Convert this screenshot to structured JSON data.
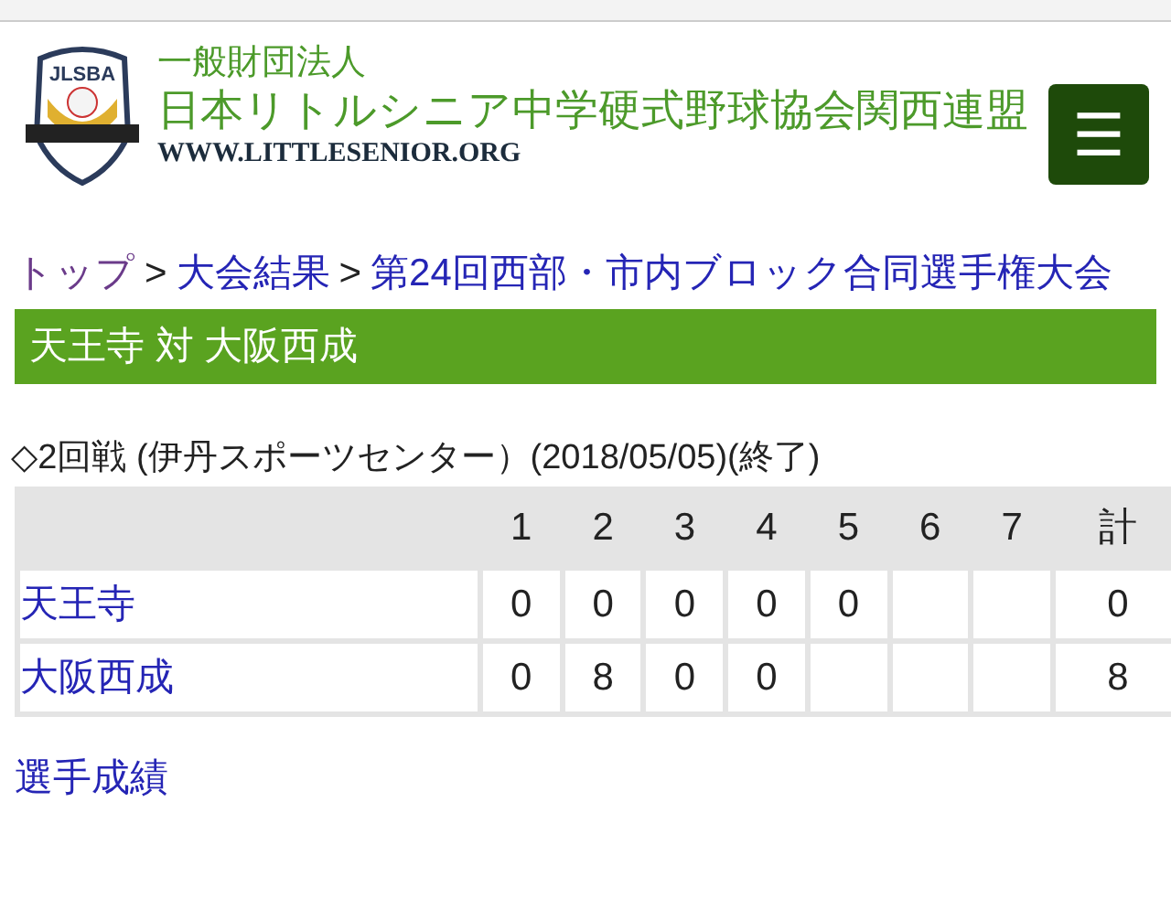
{
  "header": {
    "logo_text": "JLSBA",
    "org_type": "一般財団法人",
    "org_name": "日本リトルシニア中学硬式野球協会関西連盟",
    "url": "WWW.LITTLESENIOR.ORG",
    "menu_button": "☰"
  },
  "breadcrumb": [
    {
      "label": "トップ",
      "visited": true
    },
    {
      "label": "大会結果",
      "visited": false
    },
    {
      "label": "第24回西部・市内ブロック合同選手権大会",
      "visited": false
    }
  ],
  "breadcrumb_separator": ">",
  "match_title": "天王寺 対 大阪西成",
  "match_info": "◇2回戦 (伊丹スポーツセンター）(2018/05/05)(終了)",
  "scoreboard": {
    "columns": [
      "1",
      "2",
      "3",
      "4",
      "5",
      "6",
      "7",
      "計"
    ],
    "rows": [
      {
        "team": "天王寺",
        "innings": [
          "0",
          "0",
          "0",
          "0",
          "0"
        ],
        "total": "0"
      },
      {
        "team": "大阪西成",
        "innings": [
          "0",
          "8",
          "0",
          "0"
        ],
        "total": "8"
      }
    ]
  },
  "player_stats_link": "選手成績"
}
